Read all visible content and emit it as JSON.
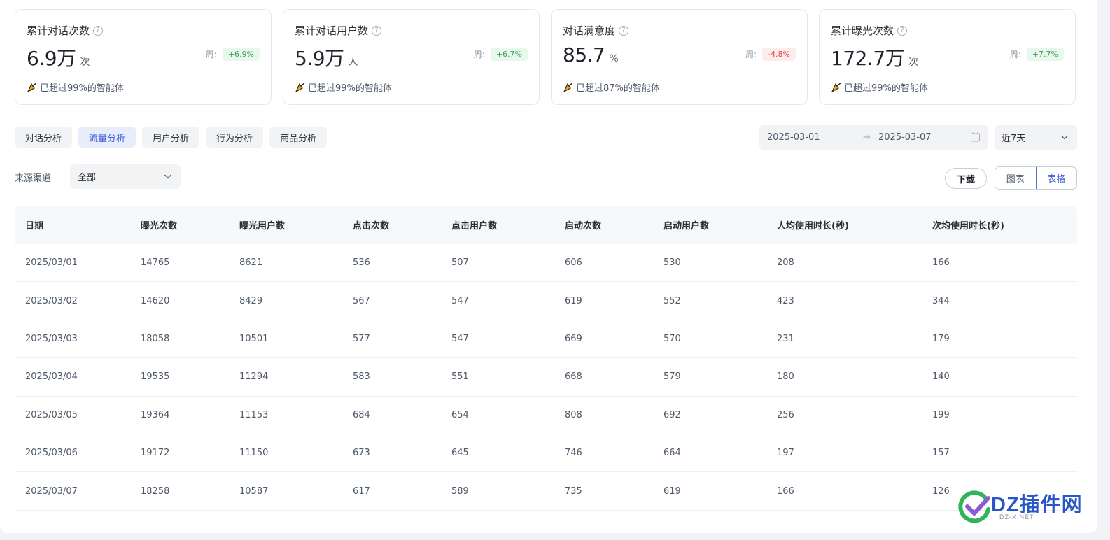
{
  "cards": [
    {
      "title": "累计对话次数",
      "value": "6.9万",
      "unit": "次",
      "week_label": "周:",
      "change": "+6.9%",
      "trend": "up",
      "foot": "已超过99%的智能体"
    },
    {
      "title": "累计对话用户数",
      "value": "5.9万",
      "unit": "人",
      "week_label": "周:",
      "change": "+6.7%",
      "trend": "up",
      "foot": "已超过99%的智能体"
    },
    {
      "title": "对话满意度",
      "value": "85.7",
      "unit": "%",
      "week_label": "周:",
      "change": "-4.8%",
      "trend": "down",
      "foot": "已超过87%的智能体"
    },
    {
      "title": "累计曝光次数",
      "value": "172.7万",
      "unit": "次",
      "week_label": "周:",
      "change": "+7.7%",
      "trend": "up",
      "foot": "已超过99%的智能体"
    }
  ],
  "tabs": [
    {
      "label": "对话分析",
      "active": false
    },
    {
      "label": "流量分析",
      "active": true
    },
    {
      "label": "用户分析",
      "active": false
    },
    {
      "label": "行为分析",
      "active": false
    },
    {
      "label": "商品分析",
      "active": false
    }
  ],
  "date_range": {
    "start": "2025-03-01",
    "arrow": "→",
    "end": "2025-03-07"
  },
  "range_select": {
    "value": "近7天"
  },
  "filter": {
    "label": "来源渠道",
    "value": "全部"
  },
  "actions": {
    "download": "下载",
    "chart": "图表",
    "table": "表格"
  },
  "table": {
    "headers": [
      "日期",
      "曝光次数",
      "曝光用户数",
      "点击次数",
      "点击用户数",
      "启动次数",
      "启动用户数",
      "人均使用时长(秒)",
      "次均使用时长(秒)"
    ],
    "rows": [
      [
        "2025/03/01",
        "14765",
        "8621",
        "536",
        "507",
        "606",
        "530",
        "208",
        "166"
      ],
      [
        "2025/03/02",
        "14620",
        "8429",
        "567",
        "547",
        "619",
        "552",
        "423",
        "344"
      ],
      [
        "2025/03/03",
        "18058",
        "10501",
        "577",
        "547",
        "669",
        "570",
        "231",
        "179"
      ],
      [
        "2025/03/04",
        "19535",
        "11294",
        "583",
        "551",
        "668",
        "579",
        "180",
        "140"
      ],
      [
        "2025/03/05",
        "19364",
        "11153",
        "684",
        "654",
        "808",
        "692",
        "256",
        "199"
      ],
      [
        "2025/03/06",
        "19172",
        "11150",
        "673",
        "645",
        "746",
        "664",
        "197",
        "157"
      ],
      [
        "2025/03/07",
        "18258",
        "10587",
        "617",
        "589",
        "735",
        "619",
        "166",
        "126"
      ]
    ]
  },
  "watermark": {
    "text": "DZ插件网",
    "sub": "DZ-X.NET"
  },
  "colors": {
    "accent": "#3b5bdb",
    "up": "#3fa35c",
    "down": "#e0474a"
  }
}
